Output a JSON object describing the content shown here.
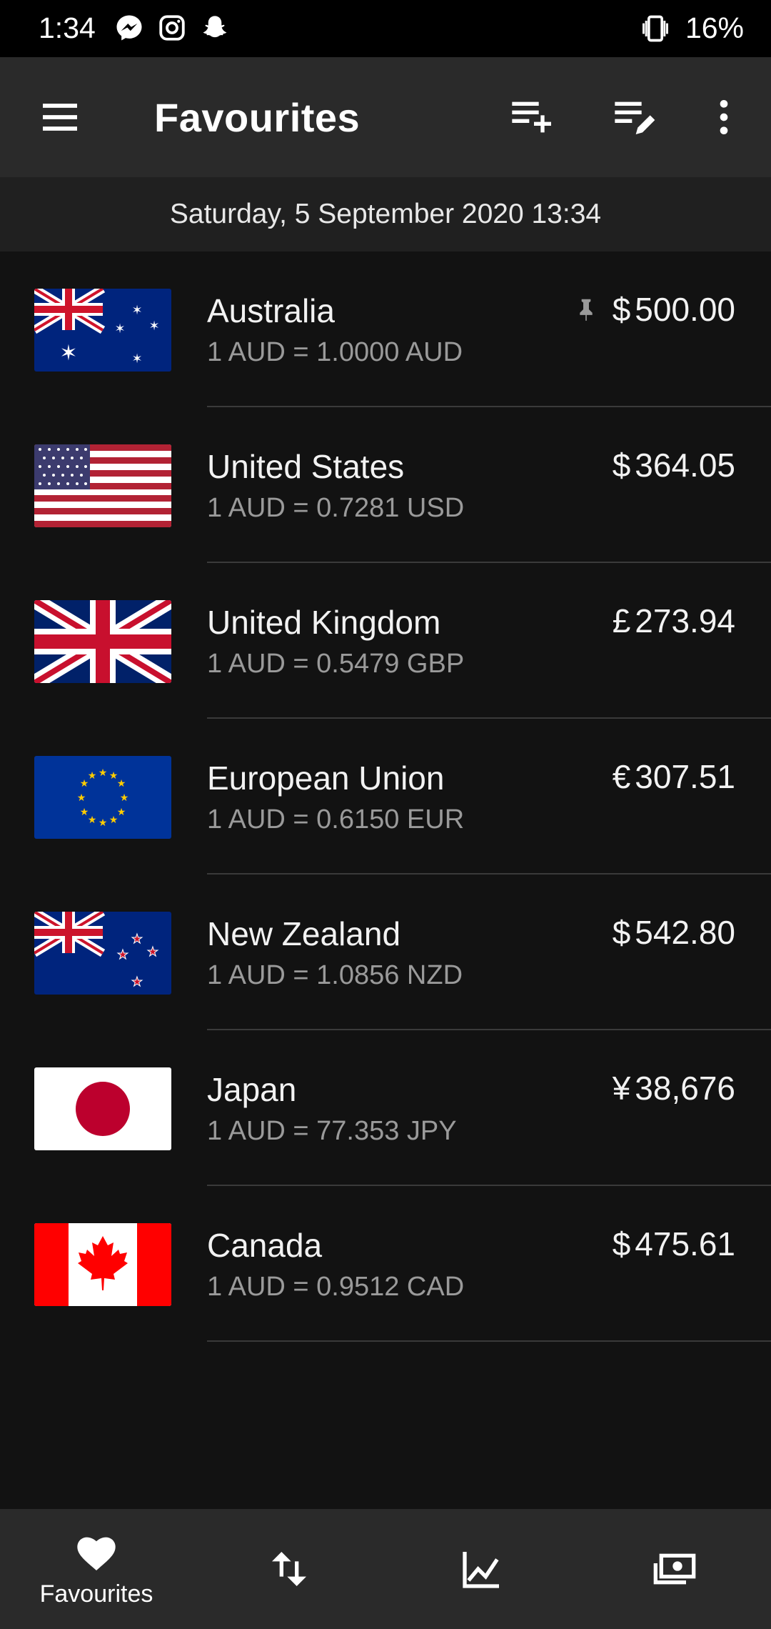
{
  "status": {
    "time": "1:34",
    "battery": "16%"
  },
  "toolbar": {
    "title": "Favourites"
  },
  "date": "Saturday, 5 September 2020 13:34",
  "currencies": [
    {
      "country": "Australia",
      "rate": "1 AUD = 1.0000 AUD",
      "symbol": "$",
      "amount": "500.00",
      "pinned": true
    },
    {
      "country": "United States",
      "rate": "1 AUD = 0.7281 USD",
      "symbol": "$",
      "amount": "364.05"
    },
    {
      "country": "United Kingdom",
      "rate": "1 AUD = 0.5479 GBP",
      "symbol": "£",
      "amount": "273.94"
    },
    {
      "country": "European Union",
      "rate": "1 AUD = 0.6150 EUR",
      "symbol": "€",
      "amount": "307.51"
    },
    {
      "country": "New Zealand",
      "rate": "1 AUD = 1.0856 NZD",
      "symbol": "$",
      "amount": "542.80"
    },
    {
      "country": "Japan",
      "rate": "1 AUD = 77.353 JPY",
      "symbol": "¥",
      "amount": "38,676"
    },
    {
      "country": "Canada",
      "rate": "1 AUD = 0.9512 CAD",
      "symbol": "$",
      "amount": "475.61"
    }
  ],
  "bottom_nav": {
    "favourites_label": "Favourites"
  }
}
